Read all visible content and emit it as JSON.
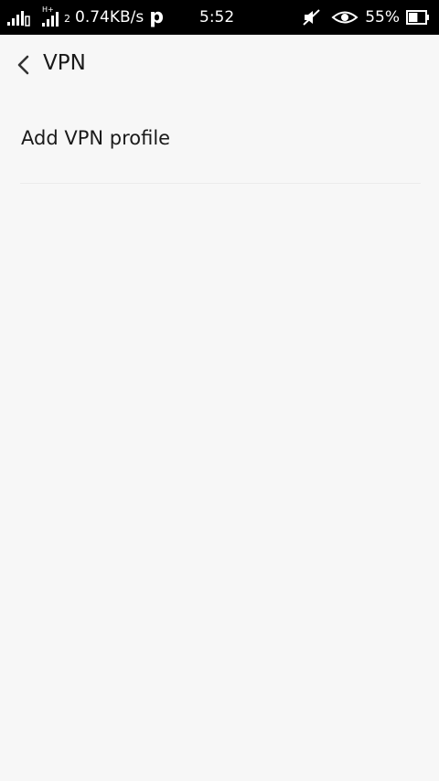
{
  "status_bar": {
    "network_speed": "0.74KB/s",
    "sim2_label": "2",
    "hplus_label": "H+",
    "time": "5:52",
    "battery_percent": "55%",
    "battery_level": 0.55,
    "icons": [
      "signal-icon",
      "signal-icon",
      "p-app-icon",
      "mute-icon",
      "eye-icon",
      "battery-icon"
    ]
  },
  "header": {
    "title": "VPN",
    "back_icon": "chevron-left-icon"
  },
  "list": {
    "items": [
      {
        "label": "Add VPN profile"
      }
    ]
  }
}
